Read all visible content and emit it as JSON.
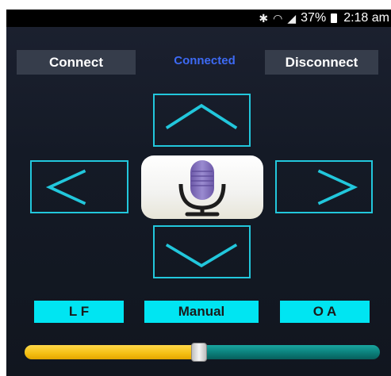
{
  "status_bar": {
    "bluetooth_icon": "bluetooth-icon",
    "wifi_icon": "wifi-icon",
    "signal_icon": "signal-icon",
    "battery": "37%",
    "time": "2:18 am"
  },
  "connection": {
    "connect_label": "Connect",
    "status_text": "Connected",
    "status_color": "#3d6af4",
    "disconnect_label": "Disconnect"
  },
  "dpad": {
    "up_icon": "chevron-up-icon",
    "down_icon": "chevron-down-icon",
    "left_icon": "chevron-left-icon",
    "right_icon": "chevron-right-icon",
    "accent_color": "#22c7dc"
  },
  "voice": {
    "icon": "microphone-icon"
  },
  "modes": {
    "left_label": "L F",
    "center_label": "Manual",
    "right_label": "O A",
    "button_color": "#00e5f2"
  },
  "slider": {
    "value_fraction": 0.49
  }
}
